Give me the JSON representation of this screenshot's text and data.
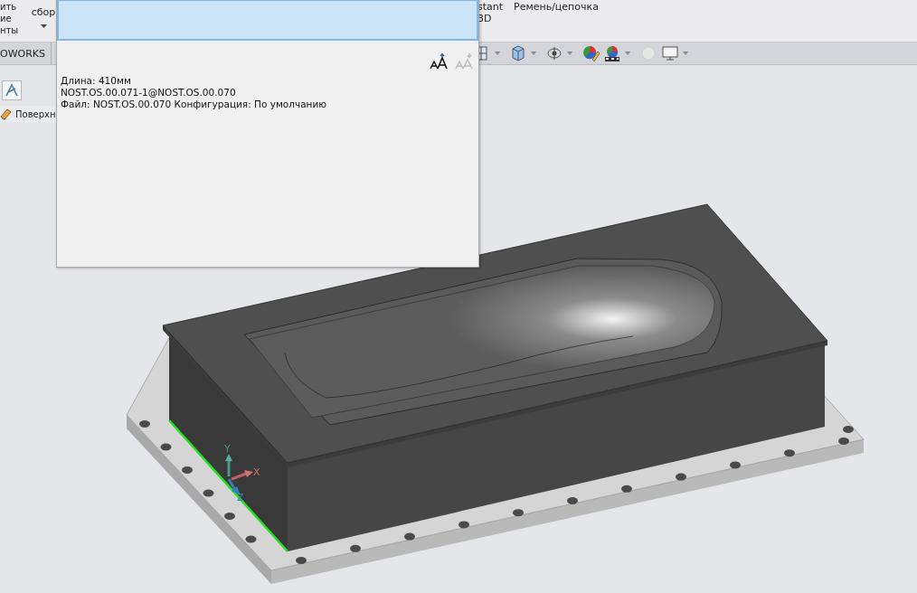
{
  "ribbon": {
    "groups": [
      {
        "lines": [
          "ить",
          "ие",
          "нты"
        ],
        "dropdown": false
      },
      {
        "lines": [
          "сбор"
        ],
        "dropdown": true
      },
      {
        "lines": [
          "stant",
          "3D"
        ],
        "dropdown": false
      },
      {
        "lines": [
          "Ремень/цепочка"
        ],
        "dropdown": false
      }
    ]
  },
  "tabs": [
    {
      "label": "OWORKS",
      "selected": false
    }
  ],
  "side_items": [
    {
      "label": "Поверхн"
    }
  ],
  "tooltip": {
    "lines": [
      "Длина: 410мм",
      "NOST.OS.00.071-1@NOST.OS.00.070",
      "Файл: NOST.OS.00.070 Конфигурация: По умолчанию"
    ]
  },
  "triad": [
    {
      "label": "Y"
    },
    {
      "label": "X"
    },
    {
      "label": "Z"
    }
  ]
}
